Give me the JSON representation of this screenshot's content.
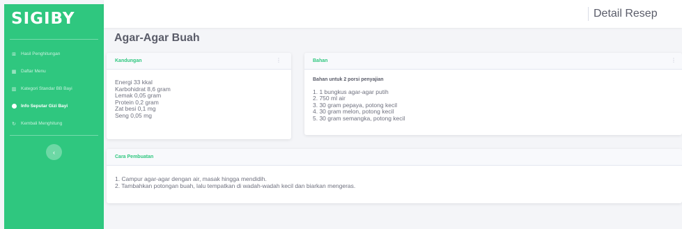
{
  "sidebar": {
    "brand": "SIGIBY",
    "items": [
      {
        "icon": "calculator-icon",
        "glyph": "⊞",
        "label": "Hasil Penghitungan",
        "active": false
      },
      {
        "icon": "table-icon",
        "glyph": "▦",
        "label": "Daftar Menu",
        "active": false
      },
      {
        "icon": "chart-icon",
        "glyph": "▥",
        "label": "Kategori Standar BB Bayi",
        "active": false
      },
      {
        "icon": "info-icon",
        "glyph": "",
        "label": "Info Seputar Gizi Bayi",
        "active": true
      },
      {
        "icon": "refresh-icon",
        "glyph": "↻",
        "label": "Kembali Menghitung",
        "active": false
      }
    ],
    "toggle_glyph": "‹"
  },
  "topbar": {
    "title": "Detail Resep"
  },
  "page": {
    "title": "Agar-Agar Buah"
  },
  "cards": {
    "kandungan": {
      "title": "Kandungan",
      "items": [
        "Energi 33 kkal",
        "Karbohidrat 8,6 gram",
        "Lemak 0,05 gram",
        "Protein 0,2 gram",
        "Zat besi 0,1 mg",
        "Seng 0,05 mg"
      ]
    },
    "bahan": {
      "title": "Bahan",
      "subtitle": "Bahan untuk 2 porsi penyajian",
      "items": [
        "1. 1 bungkus agar-agar putih",
        "2. 750 ml air",
        "3. 30 gram pepaya, potong kecil",
        "4. 30 gram melon, potong kecil",
        "5. 30 gram semangka, potong kecil"
      ]
    },
    "cara": {
      "title": "Cara Pembuatan",
      "items": [
        "1. Campur agar-agar dengan air, masak hingga mendidih.",
        "2. Tambahkan potongan buah, lalu tempatkan di wadah-wadah kecil dan biarkan mengeras."
      ]
    }
  },
  "colors": {
    "accent": "#2fc77f",
    "background": "#f4f5f8",
    "text": "#6e707e"
  }
}
